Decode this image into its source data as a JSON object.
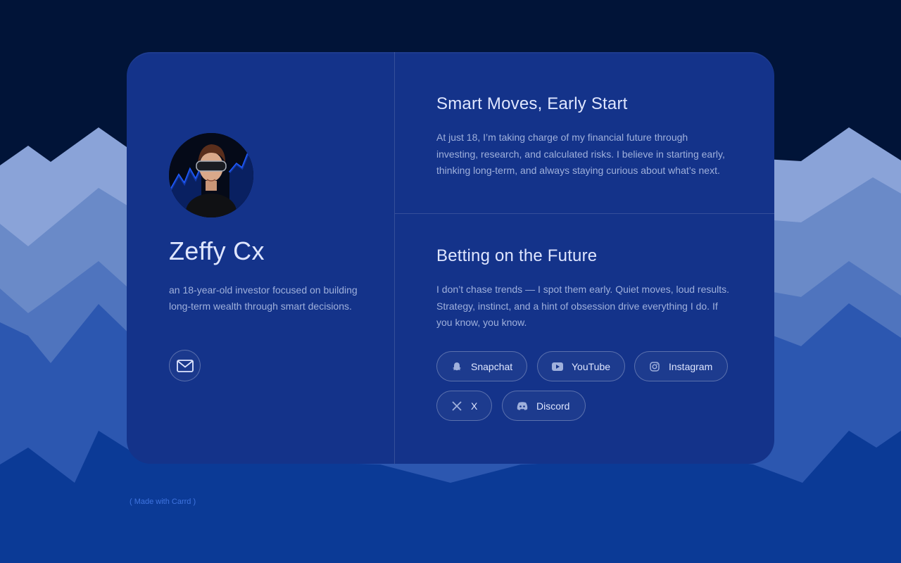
{
  "profile": {
    "name": "Zeffy Cx",
    "bio": "an 18-year-old investor focused on building long-term wealth through smart decisions.",
    "contact_icon": "mail-icon"
  },
  "sections": [
    {
      "title": "Smart Moves, Early Start",
      "body": "At just 18, I’m taking charge of my financial future through investing, research, and calculated risks. I believe in starting early, thinking long-term, and always staying curious about what’s next."
    },
    {
      "title": "Betting on the Future",
      "body": "I don’t chase trends — I spot them early. Quiet moves, loud results. Strategy, instinct, and a hint of obsession drive everything I do. If you know, you know."
    }
  ],
  "socials": [
    {
      "label": "Snapchat",
      "icon": "snapchat-icon"
    },
    {
      "label": "YouTube",
      "icon": "youtube-icon"
    },
    {
      "label": "Instagram",
      "icon": "instagram-icon"
    },
    {
      "label": "X",
      "icon": "x-icon"
    },
    {
      "label": "Discord",
      "icon": "discord-icon"
    }
  ],
  "footer": {
    "made_with": "( Made with Carrd )"
  },
  "colors": {
    "background_dark": "#011438",
    "background_blue": "#0b3a96",
    "card": "#14338a",
    "heading_text": "#dfe6ff",
    "body_text": "#9fb0dc"
  }
}
